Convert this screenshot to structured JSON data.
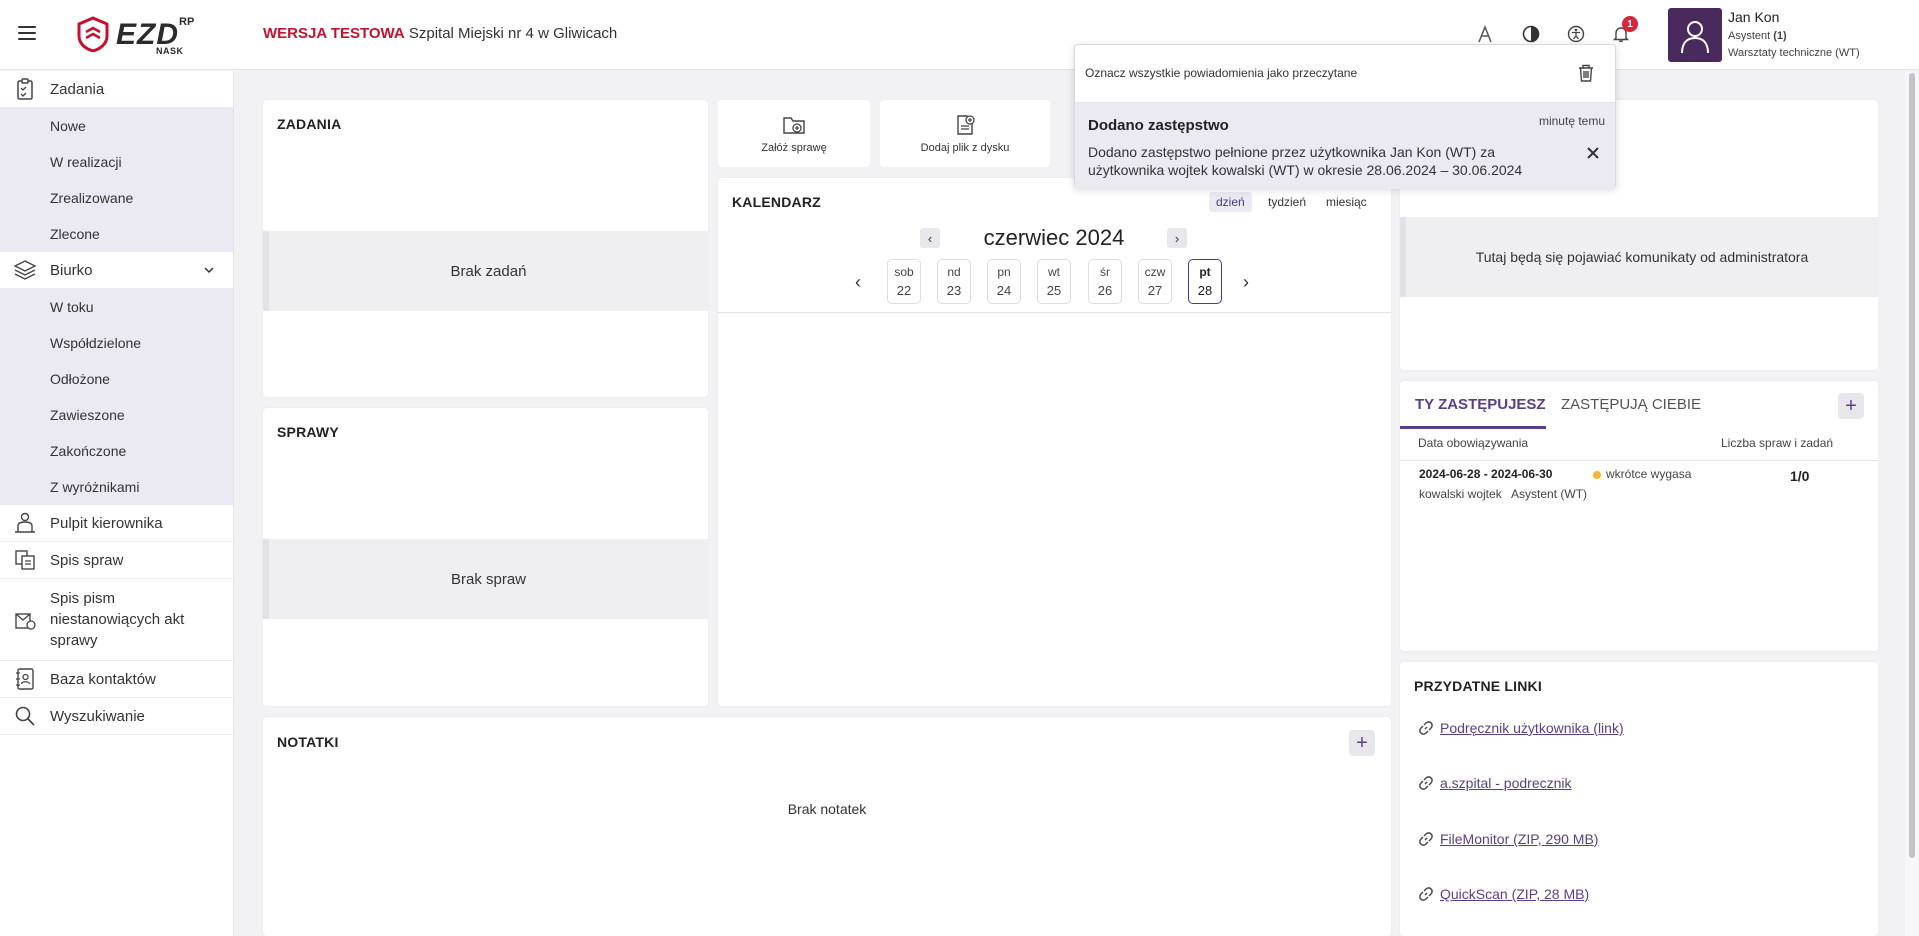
{
  "header": {
    "logo_main": "EZD",
    "logo_sup": "RP",
    "logo_sub": "NASK",
    "env_label": "WERSJA TESTOWA",
    "institution": "Szpital Miejski nr 4 w Gliwicach",
    "notification_count": "1",
    "icons": [
      "font-size-icon",
      "contrast-icon",
      "accessibility-icon",
      "bell-icon"
    ]
  },
  "user": {
    "name": "Jan Kon",
    "role": "Asystent",
    "role_count": "(1)",
    "unit": "Warsztaty techniczne (WT)"
  },
  "sidebar": {
    "zadania": {
      "label": "Zadania",
      "items": [
        "Nowe",
        "W realizacji",
        "Zrealizowane",
        "Zlecone"
      ]
    },
    "biurko": {
      "label": "Biurko",
      "items": [
        "W toku",
        "Współdzielone",
        "Odłożone",
        "Zawieszone",
        "Zakończone",
        "Z wyróżnikami"
      ]
    },
    "pulpit": "Pulpit kierownika",
    "spis_spraw": "Spis spraw",
    "spis_pism": "Spis pism niestanowiących akt sprawy",
    "kontakty": "Baza kontaktów",
    "wyszukiwanie": "Wyszukiwanie"
  },
  "tasks_panel": {
    "title": "ZADANIA",
    "empty": "Brak zadań"
  },
  "cases_panel": {
    "title": "SPRAWY",
    "empty": "Brak spraw"
  },
  "notes_panel": {
    "title": "NOTATKI",
    "empty": "Brak notatek"
  },
  "quick_actions": {
    "create_case": "Załóż sprawę",
    "add_file": "Dodaj plik z dysku"
  },
  "calendar": {
    "title": "KALENDARZ",
    "views": {
      "day": "dzień",
      "week": "tydzień",
      "month": "miesiąc"
    },
    "month_label": "czerwiec 2024",
    "days": [
      {
        "name": "sob",
        "num": "22"
      },
      {
        "name": "nd",
        "num": "23"
      },
      {
        "name": "pn",
        "num": "24"
      },
      {
        "name": "wt",
        "num": "25"
      },
      {
        "name": "śr",
        "num": "26"
      },
      {
        "name": "czw",
        "num": "27"
      },
      {
        "name": "pt",
        "num": "28"
      }
    ]
  },
  "admin_panel": {
    "message": "Tutaj będą się pojawiać komunikaty od administratora"
  },
  "replacements": {
    "tab_active": "TY ZASTĘPUJESZ",
    "tab_other": "ZASTĘPUJĄ CIEBIE",
    "col_date": "Data obowiązywania",
    "col_count": "Liczba spraw i zadań",
    "row": {
      "range": "2024-06-28 - 2024-06-30",
      "status": "wkrótce wygasa",
      "status_color": "#f5b731",
      "person": "kowalski wojtek",
      "role": "Asystent (WT)",
      "count": "1/0"
    }
  },
  "links_panel": {
    "title": "PRZYDATNE LINKI",
    "links": [
      "Podręcznik użytkownika (link)",
      "a.szpital - podrecznik",
      "FileMonitor (ZIP, 290 MB)",
      "QuickScan (ZIP, 28 MB)"
    ]
  },
  "notification": {
    "mark_all": "Oznacz wszystkie powiadomienia jako przeczytane",
    "title": "Dodano zastępstwo",
    "time": "minutę temu",
    "body": "Dodano zastępstwo pełnione przez użytkownika Jan Kon (WT) za użytkownika wojtek kowalski (WT) w okresie 28.06.2024 – 30.06.2024"
  },
  "colors": {
    "accent": "#5b3f86",
    "brand_red": "#c8102e",
    "nav_bg": "#ebe9f1"
  }
}
